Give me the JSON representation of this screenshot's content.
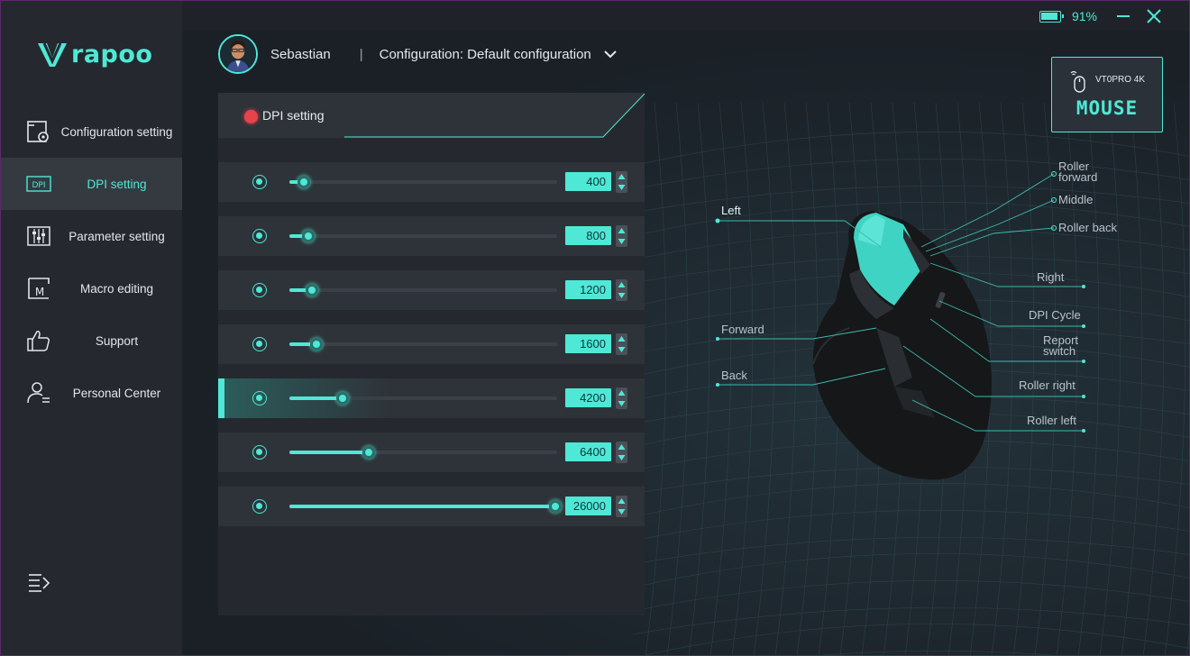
{
  "brand": {
    "name": "rapoo",
    "accent": "#4fe8d6"
  },
  "sidebar": {
    "items": [
      {
        "label": "Configuration setting",
        "icon": "configuration-icon",
        "active": false
      },
      {
        "label": "DPI setting",
        "icon": "dpi-icon",
        "active": true
      },
      {
        "label": "Parameter setting",
        "icon": "sliders-icon",
        "active": false
      },
      {
        "label": "Macro editing",
        "icon": "macro-icon",
        "active": false
      },
      {
        "label": "Support",
        "icon": "thumbs-up-icon",
        "active": false
      },
      {
        "label": "Personal Center",
        "icon": "person-icon",
        "active": false
      }
    ]
  },
  "topbar": {
    "battery_percent": "91%",
    "battery_level": 0.91
  },
  "header": {
    "user_name": "Sebastian",
    "separator": "|",
    "configuration": "Configuration: Default configuration"
  },
  "panel": {
    "title": "DPI setting",
    "dpi_max": 26000,
    "rows": [
      {
        "value": "400",
        "level": 0.015,
        "active": false
      },
      {
        "value": "800",
        "level": 0.031,
        "active": false
      },
      {
        "value": "1200",
        "level": 0.046,
        "active": false
      },
      {
        "value": "1600",
        "level": 0.062,
        "active": false
      },
      {
        "value": "4200",
        "level": 0.16,
        "active": true
      },
      {
        "value": "6400",
        "level": 0.26,
        "active": false
      },
      {
        "value": "26000",
        "level": 1.0,
        "active": false
      }
    ]
  },
  "device": {
    "model": "VT0PRO 4K",
    "kind": "MOUSE"
  },
  "callouts": {
    "left": "Left",
    "roller_forward_1": "Roller",
    "roller_forward_2": "forward",
    "middle": "Middle",
    "roller_back": "Roller back",
    "right": "Right",
    "dpi_cycle": "DPI Cycle",
    "report_switch_1": "Report",
    "report_switch_2": "switch",
    "forward": "Forward",
    "back": "Back",
    "roller_right": "Roller right",
    "roller_left": "Roller left"
  }
}
